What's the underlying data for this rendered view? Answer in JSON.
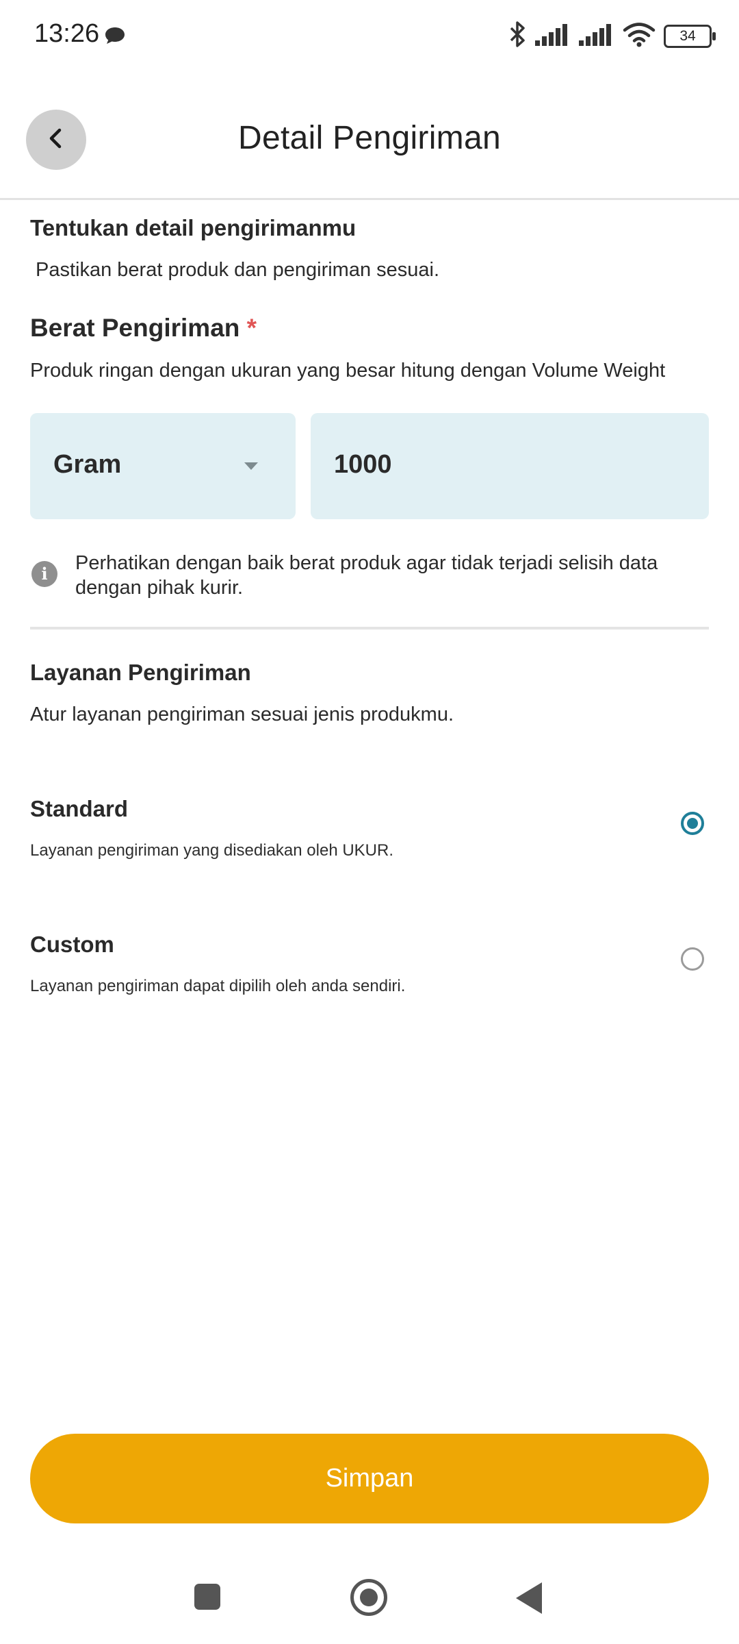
{
  "status_bar": {
    "time": "13:26",
    "battery": "34",
    "icons": [
      "chat-notification-icon",
      "bluetooth-icon",
      "signal-icon",
      "signal-icon",
      "wifi-icon",
      "battery-icon"
    ]
  },
  "header": {
    "title": "Detail Pengiriman",
    "back_icon": "chevron-left-icon"
  },
  "intro": {
    "heading": "Tentukan detail pengirimanmu",
    "subtext": "Pastikan berat produk dan pengiriman sesuai."
  },
  "weight": {
    "label": "Berat Pengiriman",
    "required_mark": "*",
    "description": "Produk ringan dengan ukuran yang besar hitung dengan Volume Weight",
    "unit": "Gram",
    "value": "1000",
    "info_line1": "Perhatikan dengan baik berat produk agar tidak terjadi selisih data",
    "info_line2": "dengan pihak kurir."
  },
  "service": {
    "heading": "Layanan Pengiriman",
    "description": "Atur layanan pengiriman sesuai jenis produkmu.",
    "options": [
      {
        "title": "Standard",
        "desc": "Layanan pengiriman yang disediakan oleh UKUR.",
        "selected": true
      },
      {
        "title": "Custom",
        "desc": "Layanan pengiriman dapat dipilih oleh anda sendiri.",
        "selected": false
      }
    ]
  },
  "actions": {
    "save_label": "Simpan"
  },
  "colors": {
    "accent": "#1f7f99",
    "button": "#eea705",
    "input_bg": "#e1f0f4",
    "required": "#e05555"
  }
}
